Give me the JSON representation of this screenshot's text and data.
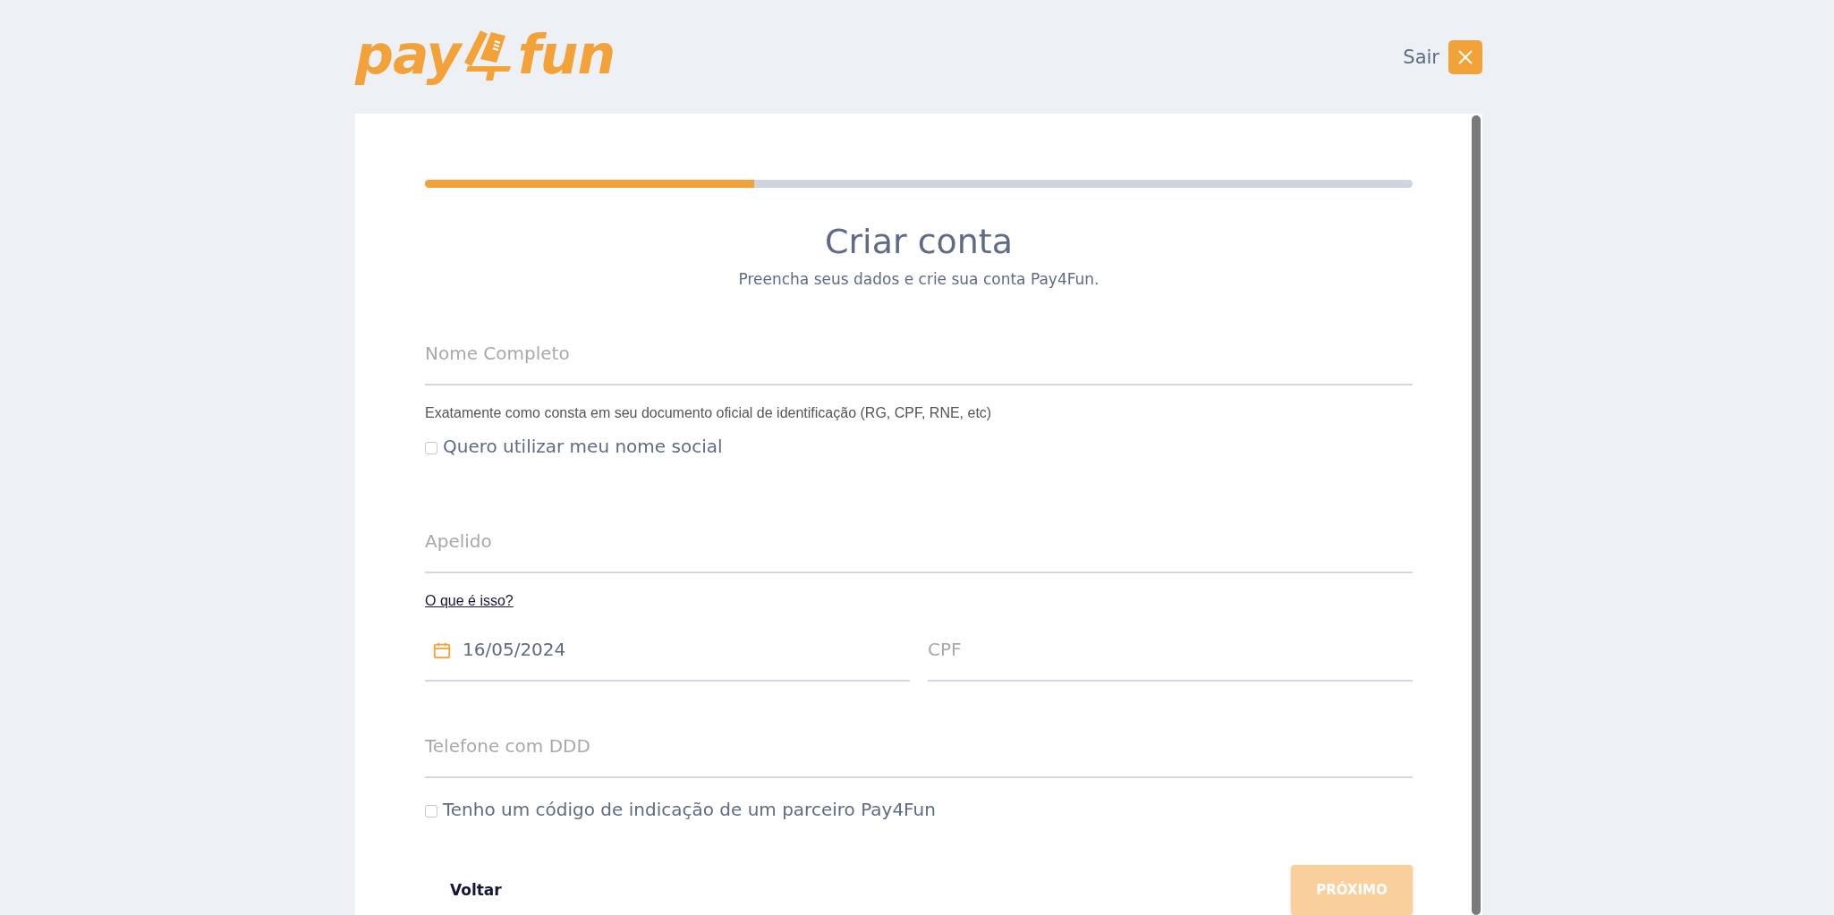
{
  "logo": {
    "left": "pay",
    "right": "fun"
  },
  "exit": {
    "label": "Sair"
  },
  "progress": {
    "level": 0.333
  },
  "title": "Criar conta",
  "subtitle": "Preencha seus dados e crie sua conta Pay4Fun.",
  "fields": [
    {
      "kind": "text",
      "placeholder": "Nome Completo"
    },
    {
      "kind": "hint",
      "text": "Exatamente como consta em seu documento oficial de identificação (RG, CPF, RNE, etc)"
    },
    {
      "kind": "checkbox",
      "label": "Quero utilizar meu nome social",
      "checked": false
    },
    {
      "kind": "text",
      "placeholder": "Apelido"
    },
    {
      "kind": "link",
      "text": "O que é isso?"
    },
    {
      "kind": "pair",
      "items": [
        {
          "kind": "date",
          "value": "16/05/2024"
        },
        {
          "kind": "text",
          "placeholder": "CPF"
        }
      ]
    },
    {
      "kind": "text",
      "placeholder": "Telefone com DDD"
    },
    {
      "kind": "checkbox",
      "label": "Tenho um código de indicação de um parceiro Pay4Fun",
      "checked": false
    }
  ],
  "back": {
    "label": "Voltar"
  },
  "next": {
    "label": "PRÓXIMO",
    "disabled": true
  }
}
